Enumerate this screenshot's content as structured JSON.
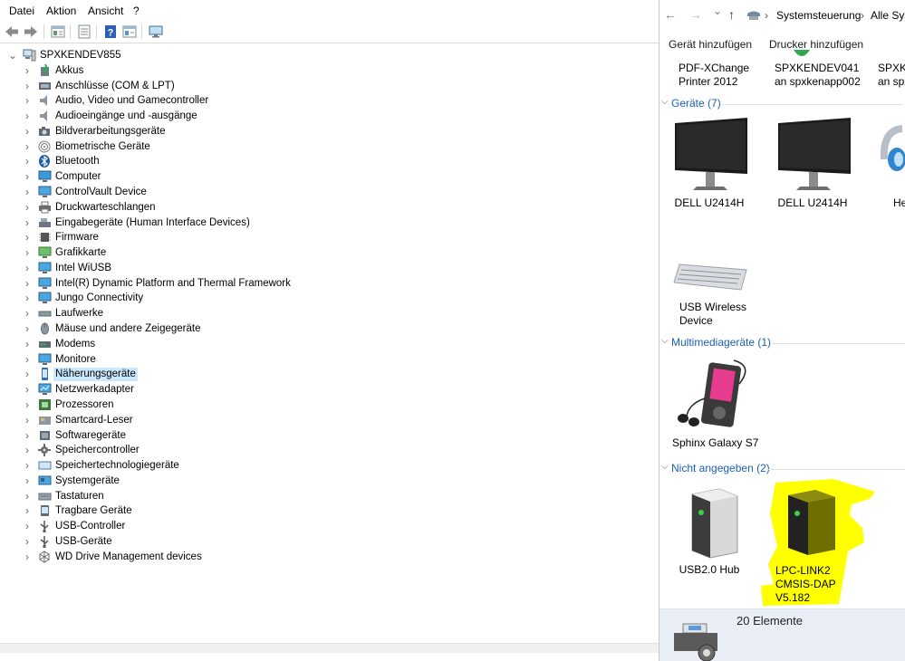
{
  "device_manager": {
    "menu": [
      "Datei",
      "Aktion",
      "Ansicht",
      "?"
    ],
    "toolbar": [
      {
        "icon": "back-arrow-icon"
      },
      {
        "icon": "forward-arrow-icon"
      },
      {
        "icon": "properties-icon"
      },
      {
        "icon": "list-view-icon"
      },
      {
        "icon": "help-icon"
      },
      {
        "icon": "details-view-icon"
      },
      {
        "icon": "monitor-scan-icon"
      }
    ],
    "root": "SPXKENDEV855",
    "items": [
      {
        "label": "Akkus",
        "icon": "battery-icon"
      },
      {
        "label": "Anschlüsse (COM & LPT)",
        "icon": "port-icon"
      },
      {
        "label": "Audio, Video und Gamecontroller",
        "icon": "speaker-icon"
      },
      {
        "label": "Audioeingänge und -ausgänge",
        "icon": "speaker-icon"
      },
      {
        "label": "Bildverarbeitungsgeräte",
        "icon": "camera-icon"
      },
      {
        "label": "Biometrische Geräte",
        "icon": "fingerprint-icon"
      },
      {
        "label": "Bluetooth",
        "icon": "bluetooth-icon"
      },
      {
        "label": "Computer",
        "icon": "computer-icon"
      },
      {
        "label": "ControlVault Device",
        "icon": "monitor-icon"
      },
      {
        "label": "Druckwarteschlangen",
        "icon": "printer-icon"
      },
      {
        "label": "Eingabegeräte (Human Interface Devices)",
        "icon": "hid-icon"
      },
      {
        "label": "Firmware",
        "icon": "chip-icon"
      },
      {
        "label": "Grafikkarte",
        "icon": "display-adapter-icon"
      },
      {
        "label": "Intel WiUSB",
        "icon": "monitor-icon"
      },
      {
        "label": "Intel(R) Dynamic Platform and Thermal Framework",
        "icon": "monitor-icon"
      },
      {
        "label": "Jungo Connectivity",
        "icon": "monitor-icon"
      },
      {
        "label": "Laufwerke",
        "icon": "drive-icon"
      },
      {
        "label": "Mäuse und andere Zeigegeräte",
        "icon": "mouse-icon"
      },
      {
        "label": "Modems",
        "icon": "modem-icon"
      },
      {
        "label": "Monitore",
        "icon": "monitor-icon"
      },
      {
        "label": "Näherungsgeräte",
        "icon": "proximity-icon"
      },
      {
        "label": "Netzwerkadapter",
        "icon": "network-icon"
      },
      {
        "label": "Prozessoren",
        "icon": "processor-icon"
      },
      {
        "label": "Smartcard-Leser",
        "icon": "smartcard-icon"
      },
      {
        "label": "Softwaregeräte",
        "icon": "software-icon"
      },
      {
        "label": "Speichercontroller",
        "icon": "storage-controller-icon"
      },
      {
        "label": "Speichertechnologiegeräte",
        "icon": "storage-icon"
      },
      {
        "label": "Systemgeräte",
        "icon": "system-icon"
      },
      {
        "label": "Tastaturen",
        "icon": "keyboard-icon"
      },
      {
        "label": "Tragbare Geräte",
        "icon": "portable-icon"
      },
      {
        "label": "USB-Controller",
        "icon": "usb-icon"
      },
      {
        "label": "USB-Geräte",
        "icon": "usb-icon"
      },
      {
        "label": "WD Drive Management devices",
        "icon": "wd-icon"
      }
    ],
    "selected_index": 20
  },
  "explorer": {
    "nav": {
      "back": "←",
      "forward": "→",
      "dropdown": "⌄",
      "up": "↑"
    },
    "breadcrumb": [
      "Systemsteuerung",
      "Alle Sys"
    ],
    "commands": [
      "Gerät hinzufügen",
      "Drucker hinzufügen"
    ],
    "top_row": [
      {
        "lines": [
          "PDF-XChange",
          "Printer 2012"
        ]
      },
      {
        "lines": [
          "SPXKENDEV041",
          "an spxkenapp002"
        ]
      },
      {
        "lines": [
          "SPXKE",
          "an spx"
        ]
      }
    ],
    "groups": {
      "devices": {
        "title": "Geräte (7)",
        "items": [
          {
            "lines": [
              "DELL U2414H"
            ],
            "icon": "monitor-icon"
          },
          {
            "lines": [
              "DELL U2414H"
            ],
            "icon": "monitor-icon"
          },
          {
            "lines": [
              "He"
            ],
            "icon": "headset-icon"
          },
          {
            "lines": [
              "USB Wireless",
              "Device"
            ],
            "icon": "keyboard-icon"
          }
        ]
      },
      "multimedia": {
        "title": "Multimediageräte (1)",
        "items": [
          {
            "lines": [
              "Sphinx Galaxy S7"
            ],
            "icon": "media-player-icon"
          }
        ]
      },
      "unspecified": {
        "title": "Nicht angegeben (2)",
        "items": [
          {
            "lines": [
              "USB2.0 Hub"
            ],
            "icon": "device-box-icon"
          },
          {
            "lines": [
              "LPC-LINK2",
              "CMSIS-DAP",
              "V5.182"
            ],
            "icon": "device-box-icon",
            "highlight": "#ffff00"
          }
        ]
      }
    },
    "status": "20 Elemente"
  }
}
